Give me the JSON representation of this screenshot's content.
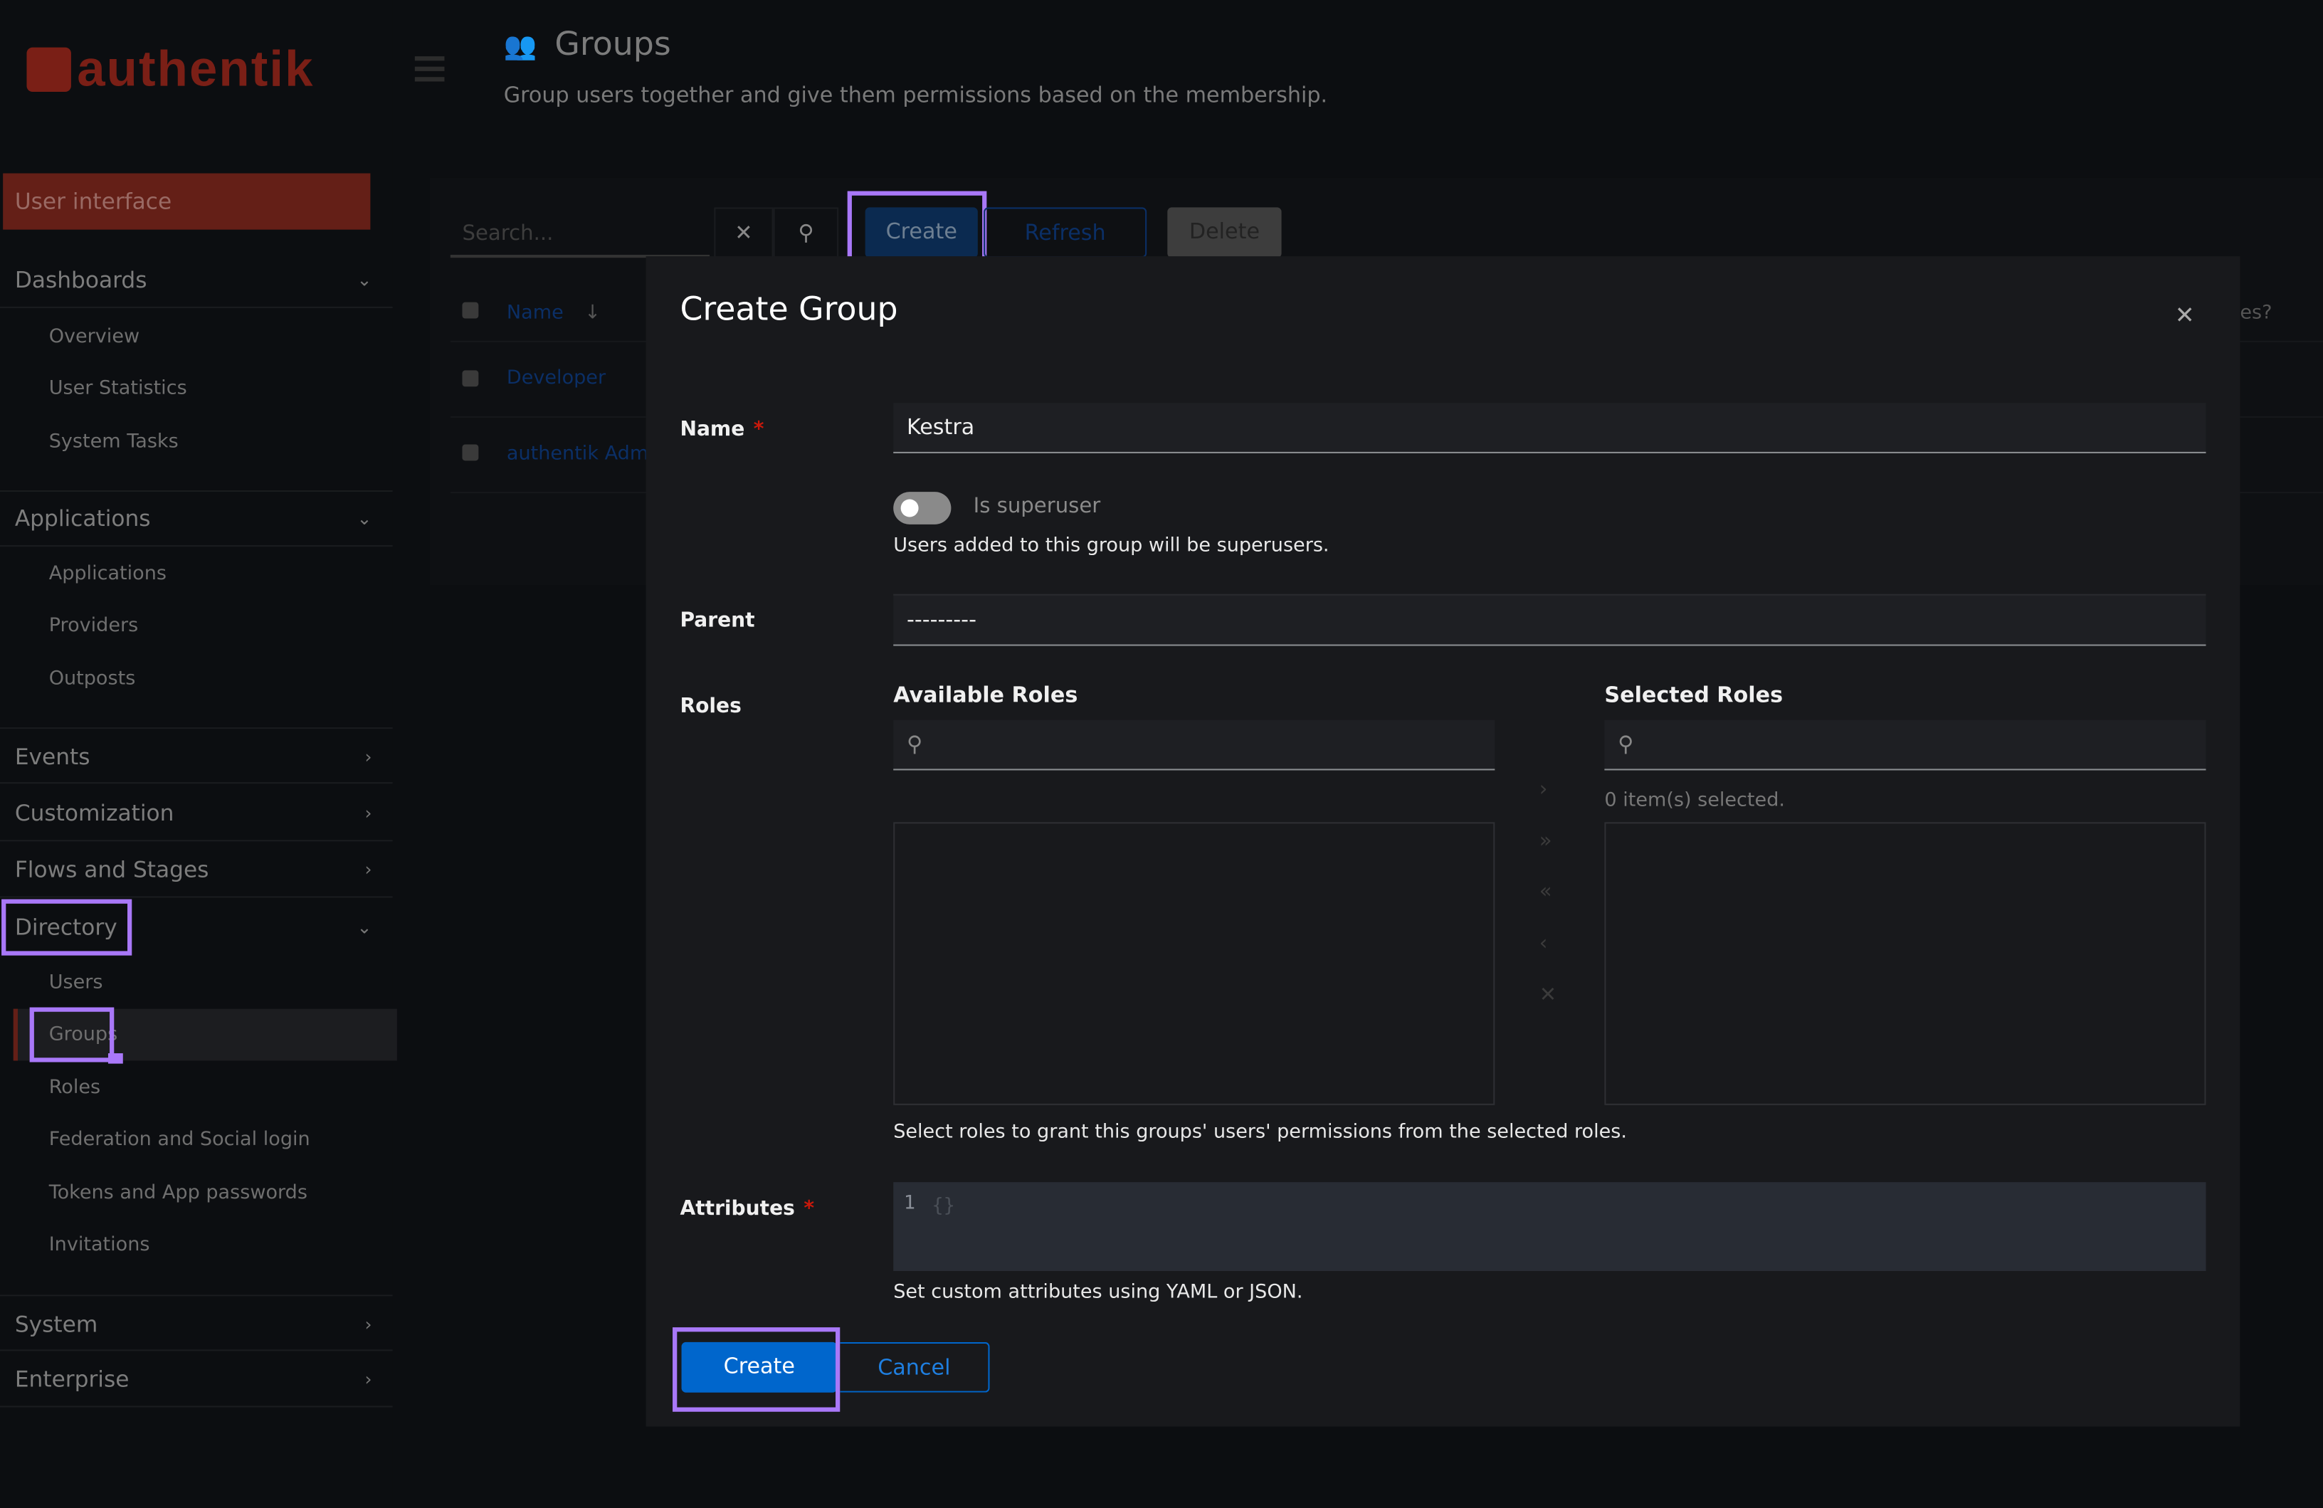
{
  "brand": {
    "name": "authentik",
    "color": "#7a1f16"
  },
  "sidebar": {
    "user_interface": "User interface",
    "sections": [
      {
        "label": "Dashboards",
        "expanded": true,
        "items": [
          "Overview",
          "User Statistics",
          "System Tasks"
        ]
      },
      {
        "label": "Applications",
        "expanded": true,
        "items": [
          "Applications",
          "Providers",
          "Outposts"
        ]
      },
      {
        "label": "Events",
        "expanded": false
      },
      {
        "label": "Customization",
        "expanded": false
      },
      {
        "label": "Flows and Stages",
        "expanded": false
      },
      {
        "label": "Directory",
        "expanded": true,
        "items": [
          "Users",
          "Groups",
          "Roles",
          "Federation and Social login",
          "Tokens and App passwords",
          "Invitations"
        ]
      },
      {
        "label": "System",
        "expanded": false
      },
      {
        "label": "Enterprise",
        "expanded": false
      }
    ],
    "active_item": "Groups"
  },
  "header": {
    "title": "Groups",
    "subtitle": "Group users together and give them permissions based on the membership.",
    "icon": "users-icon"
  },
  "toolbar": {
    "search_placeholder": "Search...",
    "create": "Create",
    "refresh": "Refresh",
    "delete": "Delete"
  },
  "table": {
    "column_name": "Name",
    "sort": "descending",
    "partial_column": "es?",
    "rows": [
      "Developer",
      "authentik Admin"
    ]
  },
  "modal": {
    "title": "Create Group",
    "name_label": "Name",
    "name_value": "Kestra",
    "superuser_label": "Is superuser",
    "superuser_on": false,
    "superuser_help": "Users added to this group will be superusers.",
    "parent_label": "Parent",
    "parent_value": "---------",
    "roles_label": "Roles",
    "available_roles": "Available Roles",
    "selected_roles": "Selected Roles",
    "selected_count": "0 item(s) selected.",
    "roles_help": "Select roles to grant this groups' users' permissions from the selected roles.",
    "attributes_label": "Attributes",
    "attributes_line_numbers": "1",
    "attributes_value": "{}",
    "attributes_help": "Set custom attributes using YAML or JSON.",
    "create": "Create",
    "cancel": "Cancel"
  },
  "colors": {
    "primary": "#0066cc",
    "highlight": "#a978f8",
    "sidebar_active": "#641f17",
    "required": "#c9190b"
  }
}
